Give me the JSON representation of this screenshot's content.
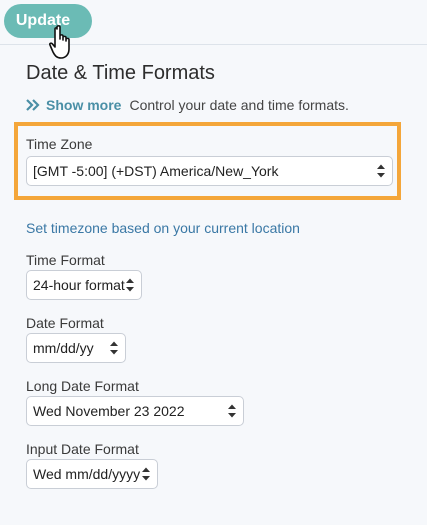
{
  "toolbar": {
    "update_label": "Update"
  },
  "page": {
    "title": "Date & Time Formats",
    "show_more_label": "Show more",
    "description": "Control your date and time formats."
  },
  "time_zone": {
    "label": "Time Zone",
    "value": "[GMT -5:00] (+DST) America/New_York"
  },
  "location_link": "Set timezone based on your current location",
  "time_format": {
    "label": "Time Format",
    "value": "24-hour format"
  },
  "date_format": {
    "label": "Date Format",
    "value": "mm/dd/yy"
  },
  "long_date_format": {
    "label": "Long Date Format",
    "value": "Wed November 23 2022"
  },
  "input_date_format": {
    "label": "Input Date Format",
    "value": "Wed mm/dd/yyyy"
  },
  "colors": {
    "accent": "#6bbbb5",
    "highlight": "#f4a63a",
    "link": "#3a78a5"
  }
}
